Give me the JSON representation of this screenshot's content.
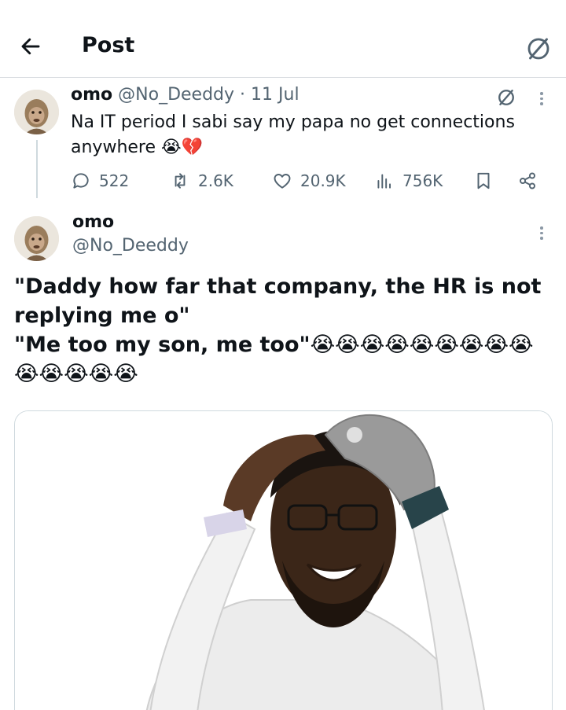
{
  "header": {
    "title": "Post"
  },
  "parent_tweet": {
    "name": "omo",
    "handle": "@No_Deeddy",
    "separator": "·",
    "date": "11 Jul",
    "text": "Na IT period I sabi say my papa no get connections anywhere 😭💔",
    "stats": {
      "replies": "522",
      "reposts": "2.6K",
      "likes": "20.9K",
      "views": "756K"
    }
  },
  "main_tweet": {
    "name": "omo",
    "handle": "@No_Deeddy",
    "text_line1": "\"Daddy how far that company, the HR is not",
    "text_line2": "replying me o\"",
    "text_line3": "\"Me too my son, me too\"😭😭😭😭😭😭😭😭😭",
    "text_line4": "😭😭😭😭😭"
  },
  "icons": {
    "back": "arrow-left-icon",
    "grok": "grok-icon",
    "more": "more-vertical-icon",
    "reply": "reply-icon",
    "repost": "repost-icon",
    "like": "heart-icon",
    "views": "views-chart-icon",
    "bookmark": "bookmark-icon",
    "share": "share-icon"
  },
  "colors": {
    "text": "#0f1419",
    "secondary": "#536471",
    "border": "#cfd9de"
  }
}
